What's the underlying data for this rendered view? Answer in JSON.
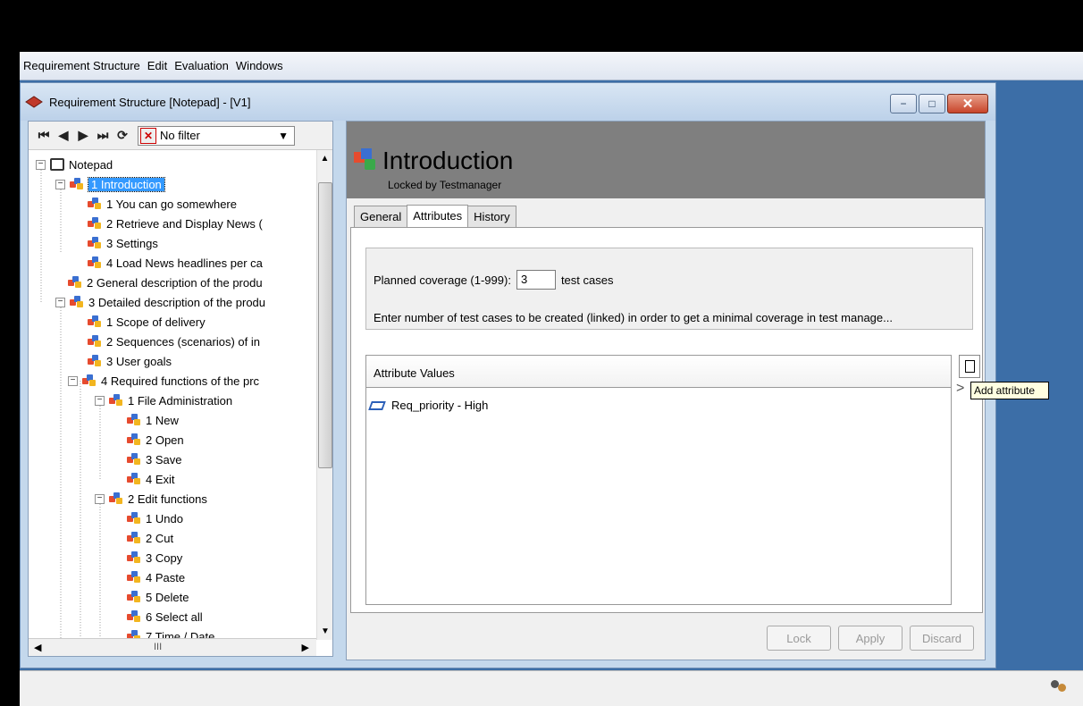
{
  "menu": [
    "Requirement Structure",
    "Edit",
    "Evaluation",
    "Windows"
  ],
  "window": {
    "title": "Requirement Structure [Notepad] - [V1]",
    "controls": {
      "minimize": "−",
      "maximize": "□",
      "close": "✕"
    }
  },
  "navbar": {
    "first": "⏮",
    "prev": "◀",
    "next": "▶",
    "last": "⏭",
    "refresh": "⟳",
    "filter_label": "No filter"
  },
  "tree": [
    {
      "label": "Notepad",
      "icon": "book-icon",
      "expander": "−"
    },
    {
      "label": "1  Introduction",
      "icon": "requirement-icon",
      "expander": "−",
      "selected": true
    },
    {
      "label": "1  You can go somewhere",
      "icon": "requirement-icon"
    },
    {
      "label": "2  Retrieve and Display News (",
      "icon": "requirement-icon"
    },
    {
      "label": "3  Settings",
      "icon": "requirement-icon"
    },
    {
      "label": "4  Load News headlines per ca",
      "icon": "requirement-icon"
    },
    {
      "label": "2  General description of the produ",
      "icon": "requirement-icon"
    },
    {
      "label": "3  Detailed description of the produ",
      "icon": "requirement-icon",
      "expander": "−"
    },
    {
      "label": "1  Scope of delivery",
      "icon": "requirement-icon"
    },
    {
      "label": "2  Sequences (scenarios) of in",
      "icon": "requirement-icon"
    },
    {
      "label": "3  User goals",
      "icon": "requirement-icon"
    },
    {
      "label": "4  Required functions of the prc",
      "icon": "requirement-icon",
      "expander": "−"
    },
    {
      "label": "1  File Administration",
      "icon": "requirement-icon",
      "expander": "−"
    },
    {
      "label": "1  New",
      "icon": "requirement-icon"
    },
    {
      "label": "2  Open",
      "icon": "requirement-icon"
    },
    {
      "label": "3  Save",
      "icon": "requirement-icon"
    },
    {
      "label": "4  Exit",
      "icon": "requirement-icon"
    },
    {
      "label": "2  Edit functions",
      "icon": "requirement-icon",
      "expander": "−"
    },
    {
      "label": "1  Undo",
      "icon": "requirement-icon"
    },
    {
      "label": "2  Cut",
      "icon": "requirement-icon"
    },
    {
      "label": "3  Copy",
      "icon": "requirement-icon"
    },
    {
      "label": "4  Paste",
      "icon": "requirement-icon"
    },
    {
      "label": "5  Delete",
      "icon": "requirement-icon"
    },
    {
      "label": "6  Select all",
      "icon": "requirement-icon"
    },
    {
      "label": "7  Time / Date",
      "icon": "requirement-icon"
    }
  ],
  "hscroll_thumb": "III",
  "detail": {
    "title": "Introduction",
    "subtitle": "Locked by Testmanager",
    "tabs": [
      "General",
      "Attributes",
      "History"
    ],
    "active_tab": "Attributes",
    "coverage_label": "Planned coverage (1-999):",
    "coverage_value": "3",
    "coverage_unit": "test cases",
    "coverage_note": "Enter number of test cases to be created (linked) in order to get a minimal coverage in test manage...",
    "attr_header": "Attribute Values",
    "attr_items": [
      "Req_priority - High"
    ],
    "tooltip": "Add attribute",
    "buttons": {
      "lock": "Lock",
      "apply": "Apply",
      "discard": "Discard"
    }
  },
  "colors": {
    "accent": "#3399ff",
    "mdi_background": "#3c6ea7",
    "header_gray": "#7f7f7f"
  }
}
